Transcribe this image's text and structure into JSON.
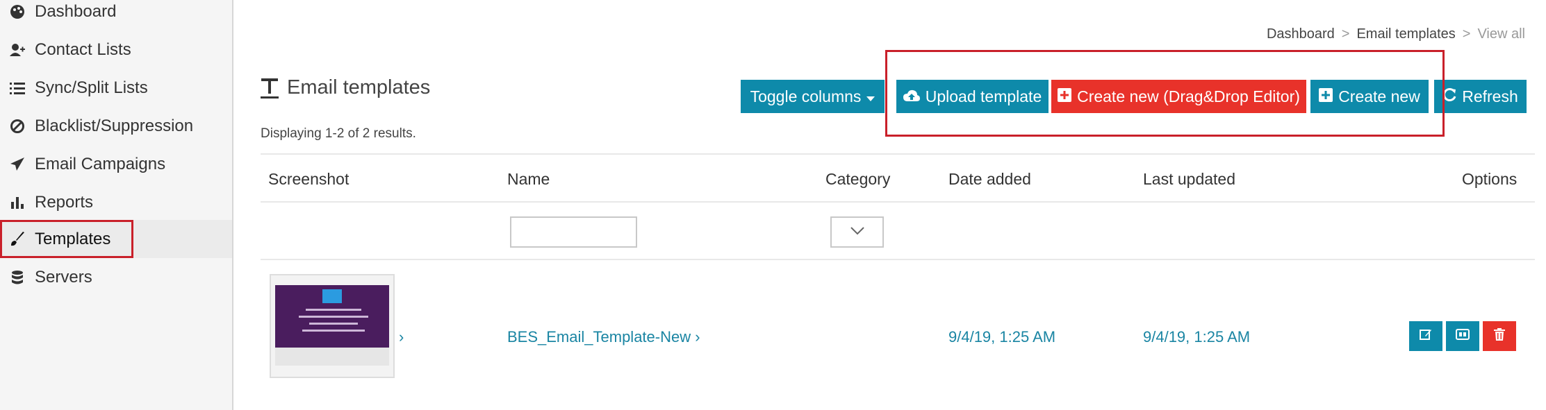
{
  "sidebar": {
    "items": [
      {
        "label": "Dashboard",
        "icon": "palette-icon"
      },
      {
        "label": "Contact Lists",
        "icon": "user-plus-icon"
      },
      {
        "label": "Sync/Split Lists",
        "icon": "list-icon"
      },
      {
        "label": "Blacklist/Suppression",
        "icon": "ban-icon"
      },
      {
        "label": "Email Campaigns",
        "icon": "paper-plane-icon"
      },
      {
        "label": "Reports",
        "icon": "bar-chart-icon"
      },
      {
        "label": "Templates",
        "icon": "brush-icon"
      },
      {
        "label": "Servers",
        "icon": "database-icon"
      }
    ]
  },
  "breadcrumb": {
    "items": [
      "Dashboard",
      "Email templates",
      "View all"
    ],
    "separator": ">"
  },
  "page": {
    "title": "Email templates",
    "summary": "Displaying 1-2 of 2 results."
  },
  "toolbar": {
    "toggle_columns": "Toggle columns",
    "upload_template": "Upload template",
    "create_dragdrop": "Create new (Drag&Drop Editor)",
    "create_new": "Create new",
    "refresh": "Refresh"
  },
  "table": {
    "headers": [
      "Screenshot",
      "Name",
      "Category",
      "Date added",
      "Last updated",
      "Options"
    ],
    "rows": [
      {
        "name": "BES_Email_Template-New",
        "date_added": "9/4/19, 1:25 AM",
        "last_updated": "9/4/19, 1:25 AM"
      }
    ]
  },
  "colors": {
    "teal": "#0e8aaa",
    "red": "#e8322a",
    "highlight": "#c9202a",
    "link": "#1a85a3"
  }
}
